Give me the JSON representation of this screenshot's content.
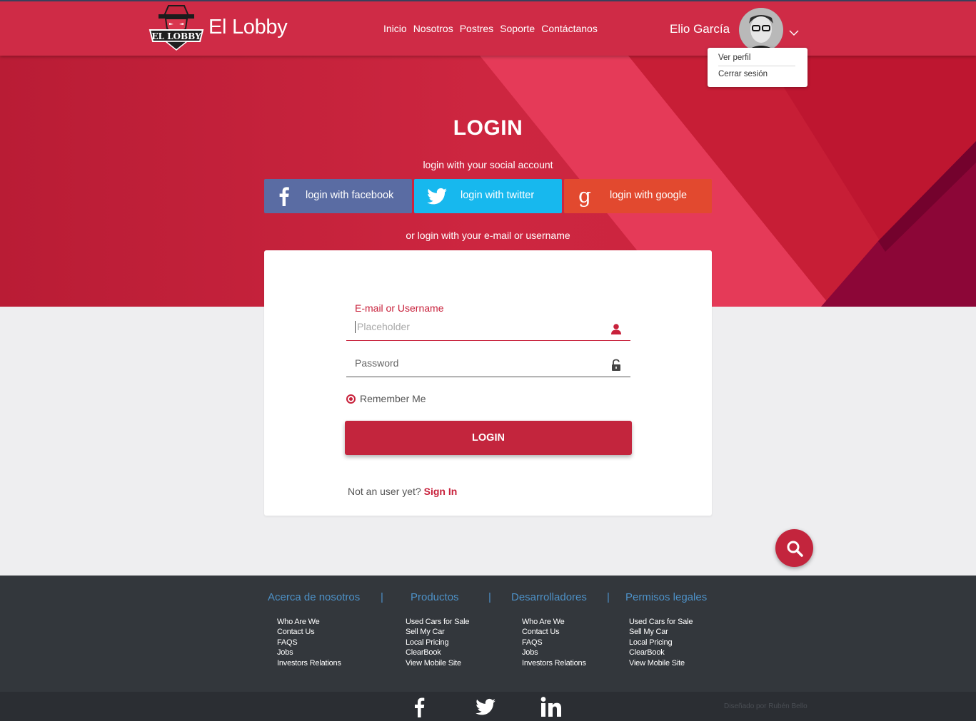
{
  "header": {
    "logo_text": "EL LOBBY",
    "brand": "El Lobby",
    "nav": [
      "Inicio",
      "Nosotros",
      "Postres",
      "Soporte",
      "Contáctanos"
    ],
    "user_name": "Elio García",
    "menu": [
      "Ver perfil",
      "Cerrar sesión"
    ]
  },
  "login": {
    "title": "LOGIN",
    "social_prompt": "login with your social account",
    "facebook": "login with facebook",
    "twitter": "login with twitter",
    "google": "login with google",
    "or_prompt": "or login with your e-mail or username",
    "user_label": "E-mail or Username",
    "user_placeholder": "Placeholder",
    "password_placeholder": "Password",
    "remember": "Remember Me",
    "button": "LOGIN",
    "not_user": "Not an user yet?",
    "sign_in": "Sign In"
  },
  "footer": {
    "columns": [
      {
        "title": "Acerca de nosotros",
        "links": [
          "Who Are We",
          "Contact Us",
          "FAQS",
          "Jobs",
          "Investors Relations"
        ]
      },
      {
        "title": "Productos",
        "links": [
          "Used Cars for Sale",
          "Sell My Car",
          "Local Pricing",
          "ClearBook",
          "View Mobile Site"
        ]
      },
      {
        "title": "Desarrolladores",
        "links": [
          "Who Are We",
          "Contact Us",
          "FAQS",
          "Jobs",
          "Investors Relations"
        ]
      },
      {
        "title": "Permisos legales",
        "links": [
          "Used Cars for Sale",
          "Sell My Car",
          "Local Pricing",
          "ClearBook",
          "View Mobile Site"
        ]
      }
    ],
    "separator": "|",
    "social_icons": [
      "facebook-icon",
      "twitter-icon",
      "linkedin-icon"
    ],
    "credit": "Diseñado por Rubén Bello"
  },
  "colors": {
    "primary_red": "#c8213b",
    "hero_red": "#cd2640",
    "facebook": "#5a6ca3",
    "twitter": "#17b8ee",
    "google": "#e2492f",
    "footer_bg": "#33373c",
    "footer_link_title": "#4d91c7"
  }
}
